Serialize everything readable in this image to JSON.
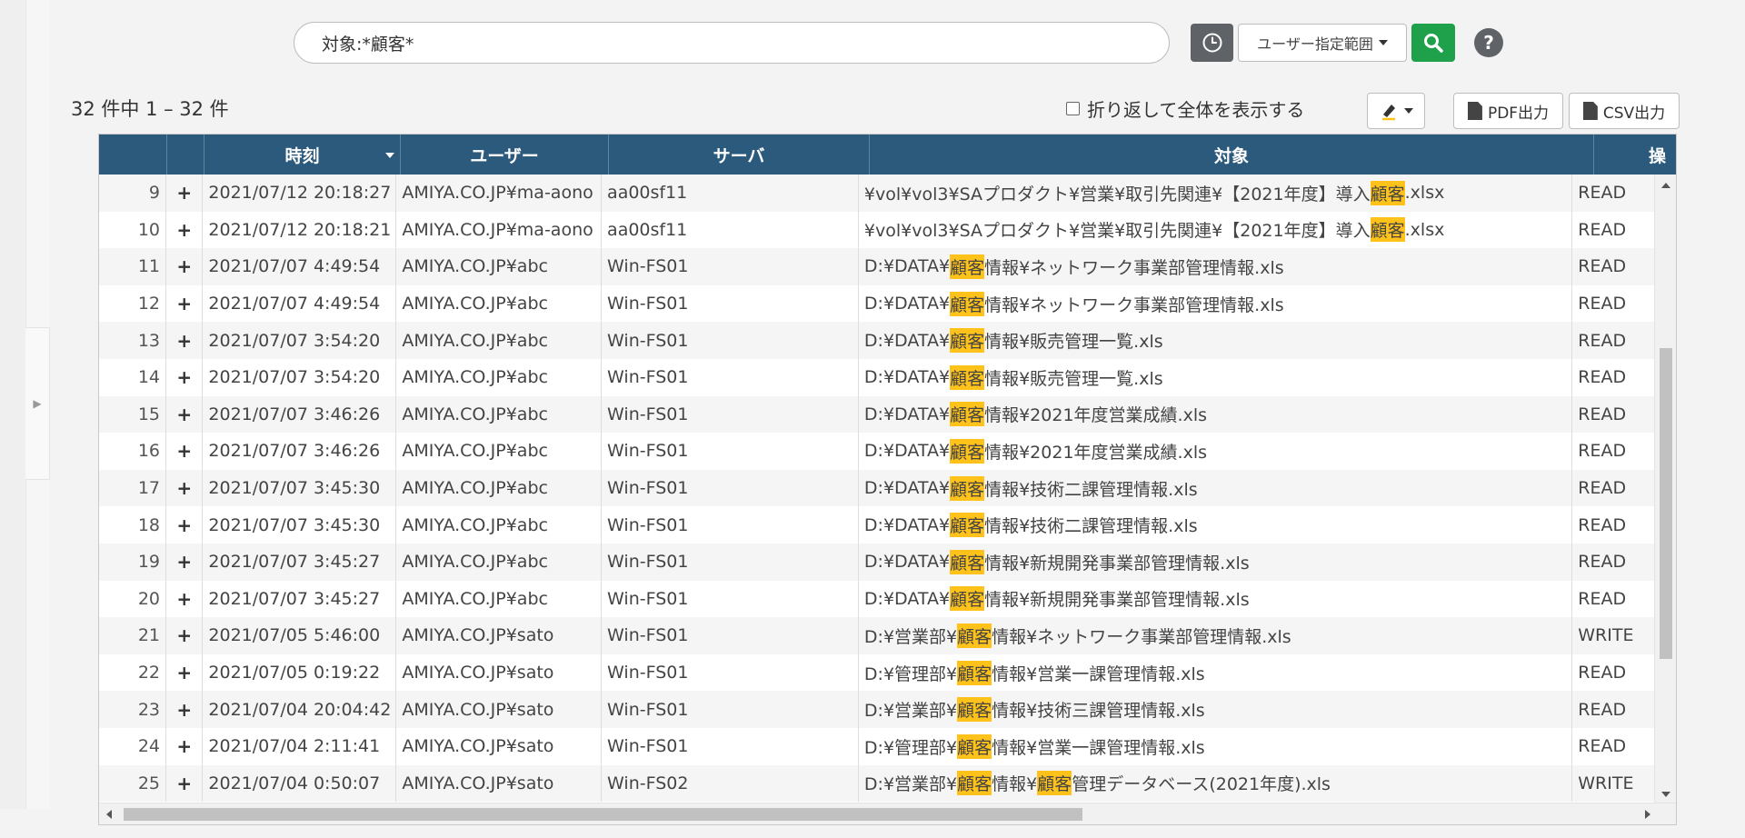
{
  "search": {
    "value": "対象:*顧客*"
  },
  "toolbar": {
    "range_label": "ユーザー指定範囲",
    "help_label": "?"
  },
  "results": {
    "count_text": "32 件中 1 – 32 件"
  },
  "options": {
    "wrap_label": "折り返して全体を表示する"
  },
  "export": {
    "pdf_label": "PDF出力",
    "csv_label": "CSV出力"
  },
  "colors": {
    "header_bg": "#2c5a7c",
    "highlight": "#ffc21a",
    "search_button": "#1fa14b"
  },
  "table": {
    "columns": [
      "",
      "",
      "時刻",
      "ユーザー",
      "サーバ",
      "対象",
      "操"
    ],
    "rows": [
      {
        "num": "9",
        "time": "2021/07/12 20:18:27",
        "user": "AMIYA.CO.JP¥ma-aono",
        "server": "aa00sf11",
        "target_pre": "¥vol¥vol3¥SAプロダクト¥営業¥取引先関連¥【2021年度】導入",
        "target_hl": "顧客",
        "target_post": " .xlsx",
        "op": "READ"
      },
      {
        "num": "10",
        "time": "2021/07/12 20:18:21",
        "user": "AMIYA.CO.JP¥ma-aono",
        "server": "aa00sf11",
        "target_pre": "¥vol¥vol3¥SAプロダクト¥営業¥取引先関連¥【2021年度】導入",
        "target_hl": "顧客",
        "target_post": ".xlsx",
        "op": "READ"
      },
      {
        "num": "11",
        "time": "2021/07/07 4:49:54",
        "user": "AMIYA.CO.JP¥abc",
        "server": "Win-FS01",
        "target_pre": "D:¥DATA¥",
        "target_hl": "顧客",
        "target_post": "情報¥ネットワーク事業部管理情報.xls",
        "op": "READ"
      },
      {
        "num": "12",
        "time": "2021/07/07 4:49:54",
        "user": "AMIYA.CO.JP¥abc",
        "server": "Win-FS01",
        "target_pre": "D:¥DATA¥",
        "target_hl": "顧客",
        "target_post": "情報¥ネットワーク事業部管理情報.xls",
        "op": "READ"
      },
      {
        "num": "13",
        "time": "2021/07/07 3:54:20",
        "user": "AMIYA.CO.JP¥abc",
        "server": "Win-FS01",
        "target_pre": "D:¥DATA¥",
        "target_hl": "顧客",
        "target_post": "情報¥販売管理一覧.xls",
        "op": "READ"
      },
      {
        "num": "14",
        "time": "2021/07/07 3:54:20",
        "user": "AMIYA.CO.JP¥abc",
        "server": "Win-FS01",
        "target_pre": "D:¥DATA¥",
        "target_hl": "顧客",
        "target_post": "情報¥販売管理一覧.xls",
        "op": "READ"
      },
      {
        "num": "15",
        "time": "2021/07/07 3:46:26",
        "user": "AMIYA.CO.JP¥abc",
        "server": "Win-FS01",
        "target_pre": "D:¥DATA¥",
        "target_hl": "顧客",
        "target_post": "情報¥2021年度営業成績.xls",
        "op": "READ"
      },
      {
        "num": "16",
        "time": "2021/07/07 3:46:26",
        "user": "AMIYA.CO.JP¥abc",
        "server": "Win-FS01",
        "target_pre": "D:¥DATA¥",
        "target_hl": "顧客",
        "target_post": "情報¥2021年度営業成績.xls",
        "op": "READ"
      },
      {
        "num": "17",
        "time": "2021/07/07 3:45:30",
        "user": "AMIYA.CO.JP¥abc",
        "server": "Win-FS01",
        "target_pre": "D:¥DATA¥",
        "target_hl": "顧客",
        "target_post": "情報¥技術二課管理情報.xls",
        "op": "READ"
      },
      {
        "num": "18",
        "time": "2021/07/07 3:45:30",
        "user": "AMIYA.CO.JP¥abc",
        "server": "Win-FS01",
        "target_pre": "D:¥DATA¥",
        "target_hl": "顧客",
        "target_post": "情報¥技術二課管理情報.xls",
        "op": "READ"
      },
      {
        "num": "19",
        "time": "2021/07/07 3:45:27",
        "user": "AMIYA.CO.JP¥abc",
        "server": "Win-FS01",
        "target_pre": "D:¥DATA¥",
        "target_hl": "顧客",
        "target_post": "情報¥新規開発事業部管理情報.xls",
        "op": "READ"
      },
      {
        "num": "20",
        "time": "2021/07/07 3:45:27",
        "user": "AMIYA.CO.JP¥abc",
        "server": "Win-FS01",
        "target_pre": "D:¥DATA¥",
        "target_hl": "顧客",
        "target_post": "情報¥新規開発事業部管理情報.xls",
        "op": "READ"
      },
      {
        "num": "21",
        "time": "2021/07/05 5:46:00",
        "user": "AMIYA.CO.JP¥sato",
        "server": "Win-FS01",
        "target_pre": "D:¥営業部¥",
        "target_hl": "顧客",
        "target_post": "情報¥ネットワーク事業部管理情報.xls",
        "op": "WRITE"
      },
      {
        "num": "22",
        "time": "2021/07/05 0:19:22",
        "user": "AMIYA.CO.JP¥sato",
        "server": "Win-FS01",
        "target_pre": "D:¥管理部¥",
        "target_hl": "顧客",
        "target_post": "情報¥営業一課管理情報.xls",
        "op": "READ"
      },
      {
        "num": "23",
        "time": "2021/07/04 20:04:42",
        "user": "AMIYA.CO.JP¥sato",
        "server": "Win-FS01",
        "target_pre": "D:¥営業部¥",
        "target_hl": "顧客",
        "target_post": "情報¥技術三課管理情報.xls",
        "op": "READ"
      },
      {
        "num": "24",
        "time": "2021/07/04 2:11:41",
        "user": "AMIYA.CO.JP¥sato",
        "server": "Win-FS01",
        "target_pre": "D:¥管理部¥",
        "target_hl": "顧客",
        "target_post": "情報¥営業一課管理情報.xls",
        "op": "READ"
      },
      {
        "num": "25",
        "time": "2021/07/04 0:50:07",
        "user": "AMIYA.CO.JP¥sato",
        "server": "Win-FS02",
        "target_pre": "D:¥営業部¥",
        "target_hl": "顧客",
        "target_post": "情報¥",
        "target_hl2": "顧客",
        "target_post2": "管理データベース(2021年度).xls",
        "op": "WRITE"
      }
    ]
  }
}
